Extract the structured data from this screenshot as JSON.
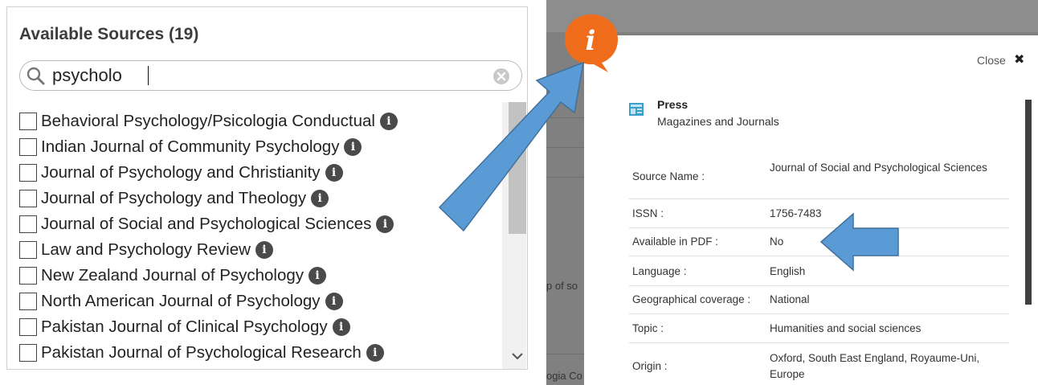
{
  "left_panel": {
    "title": "Available Sources (19)",
    "search": {
      "value": "psycholo"
    },
    "items": [
      {
        "label": "Behavioral Psychology/Psicologia Conductual"
      },
      {
        "label": "Indian Journal of Community Psychology"
      },
      {
        "label": "Journal of Psychology and Christianity"
      },
      {
        "label": "Journal of Psychology and Theology"
      },
      {
        "label": "Journal of Social and Psychological Sciences"
      },
      {
        "label": "Law and Psychology Review"
      },
      {
        "label": "New Zealand Journal of Psychology"
      },
      {
        "label": "North American Journal of Psychology"
      },
      {
        "label": "Pakistan Journal of Clinical Psychology"
      },
      {
        "label": "Pakistan Journal of Psychological Research"
      }
    ],
    "info_glyph": "i"
  },
  "background": {
    "fragment1": "p of so",
    "fragment2": "ogia Co"
  },
  "modal": {
    "close_label": "Close",
    "close_glyph": "✖",
    "press_title": "Press",
    "press_subtitle": "Magazines and Journals",
    "rows": [
      {
        "label": "Source Name :",
        "value": "Journal of Social and Psychological Sciences"
      },
      {
        "label": "ISSN :",
        "value": "1756-7483"
      },
      {
        "label": "Available in PDF :",
        "value": "No"
      },
      {
        "label": "Language :",
        "value": "English"
      },
      {
        "label": "Geographical coverage :",
        "value": "National"
      },
      {
        "label": "Topic :",
        "value": "Humanities and social sciences"
      },
      {
        "label": "Origin :",
        "value": "Oxford, South East England, Royaume-Uni, Europe"
      }
    ]
  },
  "bubble": {
    "glyph": "i",
    "color": "#ef6c1a"
  },
  "colors": {
    "arrow": "#5b9bd5",
    "arrow_stroke": "#41719c",
    "info_badge": "#4a4a4a",
    "overlay": "#808080"
  }
}
